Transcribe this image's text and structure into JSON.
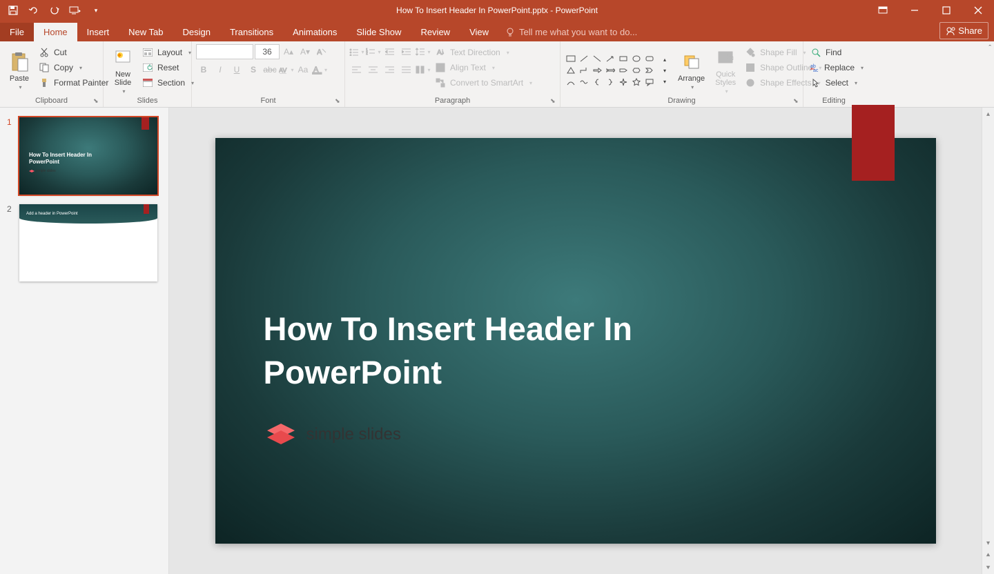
{
  "title": "How To Insert Header In PowerPoint.pptx - PowerPoint",
  "tabs": {
    "file": "File",
    "home": "Home",
    "insert": "Insert",
    "newtab": "New Tab",
    "design": "Design",
    "transitions": "Transitions",
    "animations": "Animations",
    "slideshow": "Slide Show",
    "review": "Review",
    "view": "View",
    "tellme": "Tell me what you want to do...",
    "share": "Share"
  },
  "ribbon": {
    "clipboard": {
      "label": "Clipboard",
      "paste": "Paste",
      "cut": "Cut",
      "copy": "Copy",
      "format_painter": "Format Painter"
    },
    "slides": {
      "label": "Slides",
      "new_slide": "New\nSlide",
      "layout": "Layout",
      "reset": "Reset",
      "section": "Section"
    },
    "font": {
      "label": "Font",
      "name_placeholder": "",
      "size": "36"
    },
    "paragraph": {
      "label": "Paragraph",
      "text_direction": "Text Direction",
      "align_text": "Align Text",
      "smartart": "Convert to SmartArt"
    },
    "drawing": {
      "label": "Drawing",
      "arrange": "Arrange",
      "quick_styles": "Quick\nStyles",
      "shape_fill": "Shape Fill",
      "shape_outline": "Shape Outline",
      "shape_effects": "Shape Effects"
    },
    "editing": {
      "label": "Editing",
      "find": "Find",
      "replace": "Replace",
      "select": "Select"
    }
  },
  "thumbs": [
    {
      "num": "1",
      "title": "How To Insert Header In\nPowerPoint",
      "logo": "simple slides"
    },
    {
      "num": "2",
      "title": "Add a header in PowerPoint"
    }
  ],
  "slide": {
    "title": "How To Insert Header In\nPowerPoint",
    "logo_text": "simple slides"
  }
}
